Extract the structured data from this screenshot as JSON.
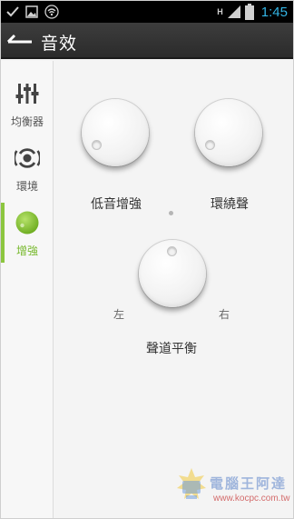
{
  "status_bar": {
    "time": "1:45",
    "network_type": "H",
    "icons": [
      "check-icon",
      "image-icon",
      "wifi-icon",
      "signal-icon",
      "battery-icon"
    ]
  },
  "action_bar": {
    "title": "音效"
  },
  "sidebar": {
    "items": [
      {
        "label": "均衡器",
        "icon": "equalizer-icon",
        "active": false
      },
      {
        "label": "環境",
        "icon": "surround-icon",
        "active": false
      },
      {
        "label": "增強",
        "icon": "enhance-icon",
        "active": true
      }
    ]
  },
  "main": {
    "bass_label": "低音增強",
    "surround_label": "環繞聲",
    "balance_label": "聲道平衡",
    "left_label": "左",
    "right_label": "右"
  },
  "colors": {
    "accent": "#8cc63f",
    "time": "#33b5e5",
    "actionbar": "#333333"
  },
  "watermark": {
    "text": "電腦王阿達",
    "url": "www.kocpc.com.tw"
  }
}
